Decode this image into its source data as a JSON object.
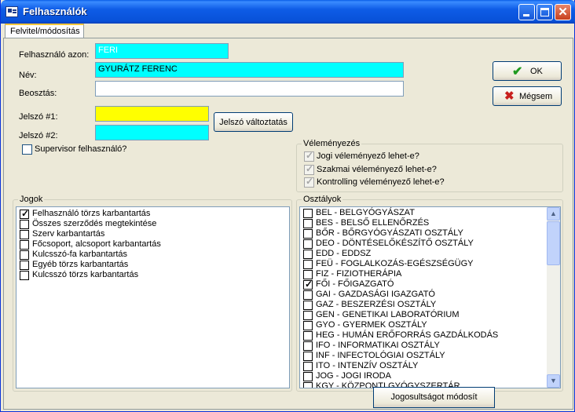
{
  "window": {
    "title": "Felhasználók"
  },
  "tabs": [
    {
      "label": "Felvitel/módosítás"
    }
  ],
  "form": {
    "azon_label": "Felhasználó azon:",
    "azon_value": "FERI",
    "nev_label": "Név:",
    "nev_value": "GYURÁTZ FERENC",
    "beosztas_label": "Beosztás:",
    "beosztas_value": "",
    "jelszo1_label": "Jelszó #1:",
    "jelszo2_label": "Jelszó #2:",
    "jelszo_button": "Jelszó változtatás",
    "supervisor_label": "Supervisor felhasználó?"
  },
  "buttons": {
    "ok": "OK",
    "megsem": "Mégsem",
    "jogosultsag": "Jogosultságot módosít"
  },
  "velemenyezes": {
    "title": "Véleményezés",
    "items": [
      {
        "label": "Jogi véleményező lehet-e?",
        "checked": true
      },
      {
        "label": "Szakmai véleményező lehet-e?",
        "checked": true
      },
      {
        "label": "Kontrolling véleményező lehet-e?",
        "checked": true
      }
    ]
  },
  "jogok": {
    "title": "Jogok",
    "items": [
      {
        "label": "Felhasználó törzs karbantartás",
        "checked": true
      },
      {
        "label": "Összes szerződés megtekintése",
        "checked": false
      },
      {
        "label": "Szerv karbantartás",
        "checked": false
      },
      {
        "label": "Főcsoport, alcsoport karbantartás",
        "checked": false
      },
      {
        "label": "Kulcsszó-fa karbantartás",
        "checked": false
      },
      {
        "label": "Egyéb törzs karbantartás",
        "checked": false
      },
      {
        "label": "Kulcsszó törzs karbantartás",
        "checked": false
      }
    ]
  },
  "osztalyok": {
    "title": "Osztályok",
    "items": [
      {
        "label": "BEL - BELGYÓGYÁSZAT",
        "checked": false
      },
      {
        "label": "BES - BELSŐ ELLENŐRZÉS",
        "checked": false
      },
      {
        "label": "BŐR - BŐRGYÓGYÁSZATI OSZTÁLY",
        "checked": false
      },
      {
        "label": "DEO - DÖNTÉSELŐKÉSZÍTŐ OSZTÁLY",
        "checked": false
      },
      {
        "label": "EDD - EDDSZ",
        "checked": false
      },
      {
        "label": "FEÜ - FOGLALKOZÁS-EGÉSZSÉGÜGY",
        "checked": false
      },
      {
        "label": "FIZ - FIZIOTHERÁPIA",
        "checked": false
      },
      {
        "label": "FŐI - FŐIGAZGATÓ",
        "checked": true
      },
      {
        "label": "GAI - GAZDASÁGI IGAZGATÓ",
        "checked": false
      },
      {
        "label": "GAZ - BESZERZÉSI OSZTÁLY",
        "checked": false
      },
      {
        "label": "GEN - GENETIKAI LABORATÓRIUM",
        "checked": false
      },
      {
        "label": "GYO - GYERMEK OSZTÁLY",
        "checked": false
      },
      {
        "label": "HEG - HUMÁN ERŐFORRÁS GAZDÁLKODÁS",
        "checked": false
      },
      {
        "label": "IFO - INFORMATIKAI OSZTÁLY",
        "checked": false
      },
      {
        "label": "INF - INFECTOLÓGIAI OSZTÁLY",
        "checked": false
      },
      {
        "label": "ITO - INTENZÍV OSZTÁLY",
        "checked": false
      },
      {
        "label": "JOG - JOGI IRODA",
        "checked": false
      },
      {
        "label": "KGY - KÖZPONTI GYÓGYSZERTÁR",
        "checked": false
      }
    ]
  },
  "colors": {
    "titlebar": "#0851d8",
    "cyan_field": "#00ffff",
    "yellow_field": "#ffff00"
  },
  "icons": {
    "ok": "check-icon",
    "cancel": "x-icon"
  }
}
